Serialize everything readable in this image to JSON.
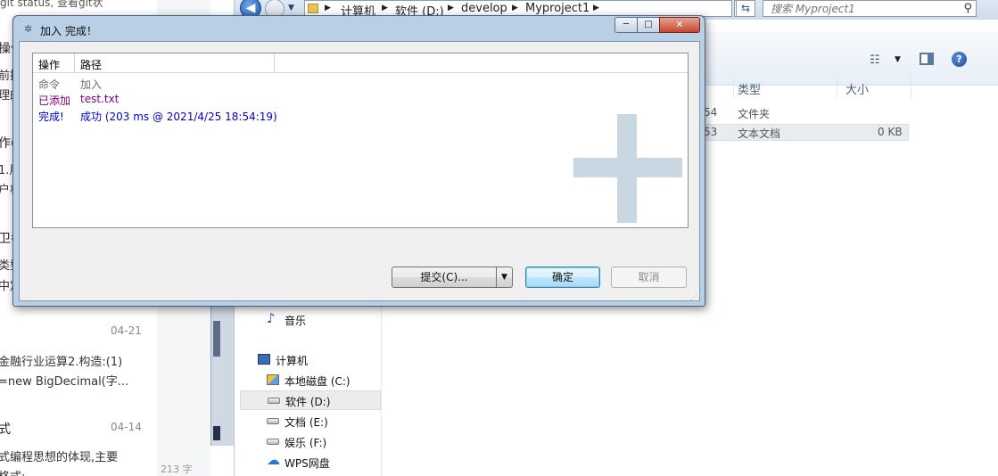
{
  "blog": {
    "lines": [
      "操作",
      "前提",
      "理的",
      "作(",
      "1.用",
      "户相",
      "卫孝",
      "类型",
      "中定"
    ],
    "top_fragment": "git status, 查看git状",
    "items": [
      {
        "date": "04-21",
        "title": "金融行业运算2.构造:(1)",
        "excerpt": "=new BigDecimal(字..."
      },
      {
        "date": "04-14",
        "title": "式",
        "excerpt": "式编程思想的体现,主要",
        "excerpt2": "格式:"
      }
    ],
    "word_count": "213 字"
  },
  "explorer": {
    "breadcrumbs": [
      "计算机",
      "软件 (D:)",
      "develop",
      "Myproject1"
    ],
    "search_placeholder": "搜索 Myproject1",
    "columns": {
      "type": "类型",
      "size": "大小"
    },
    "files": [
      {
        "date_frag": "54",
        "type": "文件夹",
        "size": ""
      },
      {
        "date_frag": "53",
        "type": "文本文档",
        "size": "0 KB"
      }
    ],
    "nav": {
      "music": "音乐",
      "computer": "计算机",
      "drives": [
        "本地磁盘 (C:)",
        "软件 (D:)",
        "文档 (E:)",
        "娱乐 (F:)"
      ],
      "wps": "WPS网盘"
    }
  },
  "dialog": {
    "title": "加入 完成！",
    "controls": {
      "minimize": "─",
      "maximize": "□",
      "close": "✕"
    },
    "list": {
      "headers": [
        "操作",
        "路径"
      ],
      "rows": [
        {
          "op": "命令",
          "path": "加入",
          "color": "#6f6f6f"
        },
        {
          "op": "已添加",
          "path": "test.txt",
          "color": "#800080"
        },
        {
          "op": "完成!",
          "path": "成功 (203 ms @ 2021/4/25 18:54:19)",
          "color": "#0000dd"
        }
      ]
    },
    "buttons": {
      "commit": "提交(C)...",
      "ok": "确定",
      "cancel": "取消"
    }
  }
}
